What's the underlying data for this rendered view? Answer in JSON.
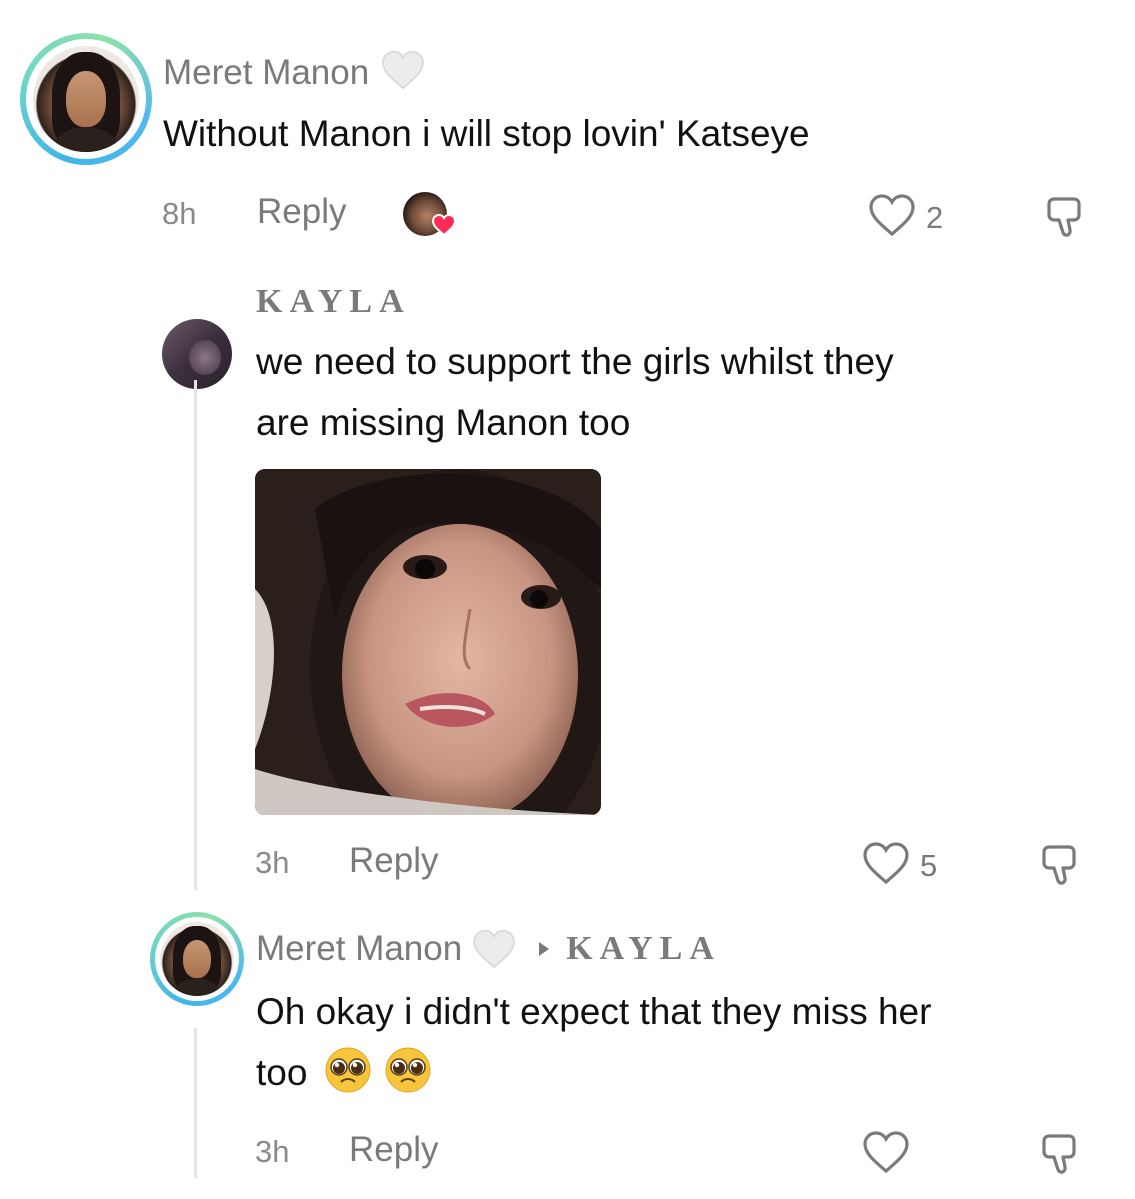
{
  "comments": [
    {
      "username": "Meret Manon",
      "text": "Without Manon i will stop lovin' Katseye",
      "time": "8h",
      "reply_label": "Reply",
      "likes": "2"
    },
    {
      "username": "KAYLA",
      "text_lines": [
        "we need to support the girls whilst they",
        "are missing Manon too"
      ],
      "time": "3h",
      "reply_label": "Reply",
      "likes": "5"
    },
    {
      "username": "Meret Manon",
      "reply_to": "KAYLA",
      "text_line1": "Oh okay i didn't expect that they miss her",
      "text_line2": "too",
      "time": "3h",
      "reply_label": "Reply"
    }
  ],
  "icons": {
    "verified_heart": "white-heart-icon",
    "like": "heart-outline-icon",
    "dislike": "thumbs-down-icon",
    "reply_arrow": "caret-right-icon",
    "emoji": "pleading-face-emoji"
  },
  "colors": {
    "like_badge": "#fe2c55",
    "avatar_ring_start": "#3fb6e8",
    "avatar_ring_end": "#8fe0a8",
    "muted_text": "#7a7a7a"
  }
}
